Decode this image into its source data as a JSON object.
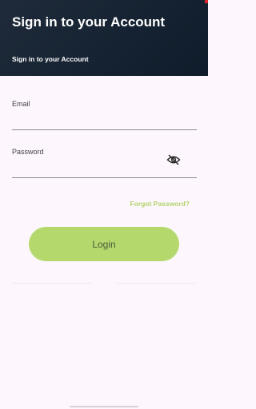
{
  "header": {
    "title": "Sign in to your Account",
    "subtitle": "Sign in to your Account"
  },
  "form": {
    "email_label": "Email",
    "password_label": "Password",
    "visibility_icon": "eye-off-icon",
    "forgot_password": "Forgot Password?",
    "login_button": "Login"
  },
  "colors": {
    "header_bg": "#1b2636",
    "accent": "#b5d86c",
    "page_bg": "#fdf7fd"
  }
}
